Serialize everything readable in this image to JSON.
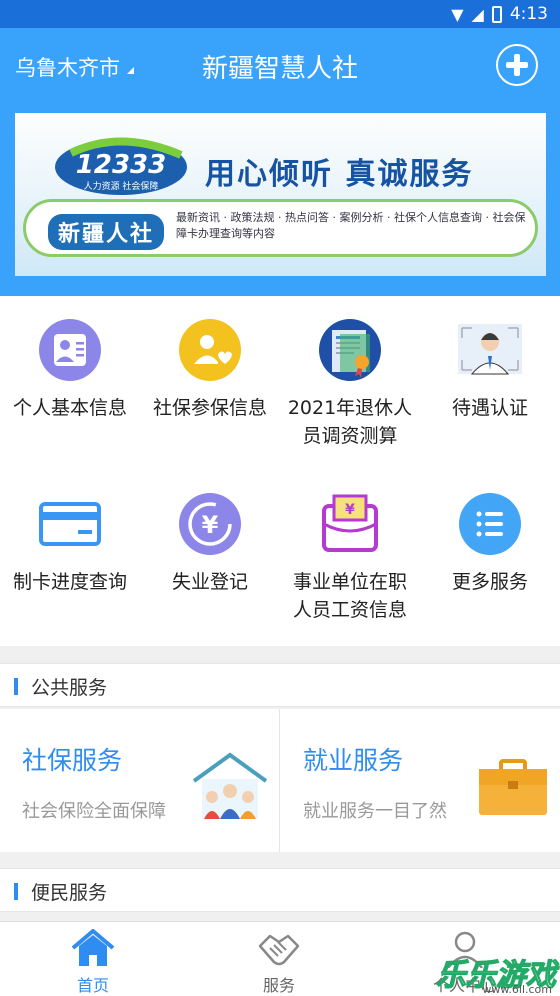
{
  "status_bar": {
    "time": "4:13"
  },
  "header": {
    "city": "乌鲁木齐市",
    "title": "新疆智慧人社"
  },
  "banner": {
    "logo_number": "12333",
    "logo_sub": "人力资源 社会保障",
    "slogan": "用心倾听 真诚服务",
    "brand": "新疆人社",
    "desc": "最新资讯 · 政策法规 · 热点问答 · 案例分析 · 社保个人信息查询 · 社会保障卡办理查询等内容"
  },
  "services": [
    {
      "label": "个人基本信息",
      "icon": "person-card-icon",
      "color": "#8c86e8"
    },
    {
      "label": "社保参保信息",
      "icon": "person-heart-icon",
      "color": "#f4c21f"
    },
    {
      "label": "2021年退休人员调资测算",
      "icon": "certificate-icon",
      "color": "#2f76cf"
    },
    {
      "label": "待遇认证",
      "icon": "face-photo-icon",
      "color": "#555"
    },
    {
      "label": "制卡进度查询",
      "icon": "card-icon",
      "color": "#3a96f5"
    },
    {
      "label": "失业登记",
      "icon": "yuan-refresh-icon",
      "color": "#8c86e8"
    },
    {
      "label": "事业单位在职人员工资信息",
      "icon": "salary-bag-icon",
      "color": "#b43ad0"
    },
    {
      "label": "更多服务",
      "icon": "list-icon",
      "color": "#42a5f5"
    }
  ],
  "public_section": {
    "title": "公共服务",
    "cards": [
      {
        "title": "社保服务",
        "subtitle": "社会保险全面保障",
        "icon": "family-house-icon"
      },
      {
        "title": "就业服务",
        "subtitle": "就业服务一目了然",
        "icon": "briefcase-icon"
      }
    ]
  },
  "convenience_section": {
    "title": "便民服务"
  },
  "tabs": [
    {
      "label": "首页",
      "icon": "home-icon",
      "active": true
    },
    {
      "label": "服务",
      "icon": "handshake-icon",
      "active": false
    },
    {
      "label": "个人中心",
      "icon": "user-icon",
      "active": false
    }
  ],
  "watermark": {
    "text": "乐乐游戏",
    "url": "www.6ll.com"
  }
}
